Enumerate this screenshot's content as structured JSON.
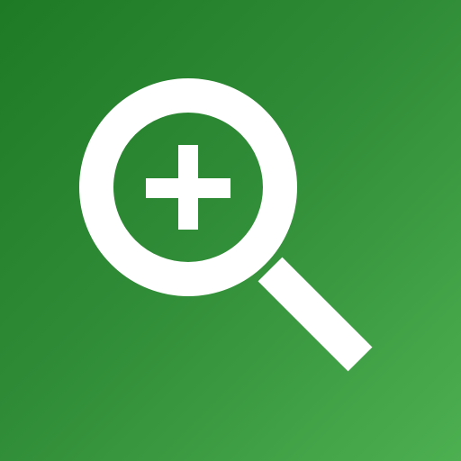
{
  "app_icon": {
    "icon": "zoom-in-icon",
    "background_gradient": [
      "#1e7a24",
      "#4caf50"
    ],
    "foreground_color": "#ffffff"
  }
}
